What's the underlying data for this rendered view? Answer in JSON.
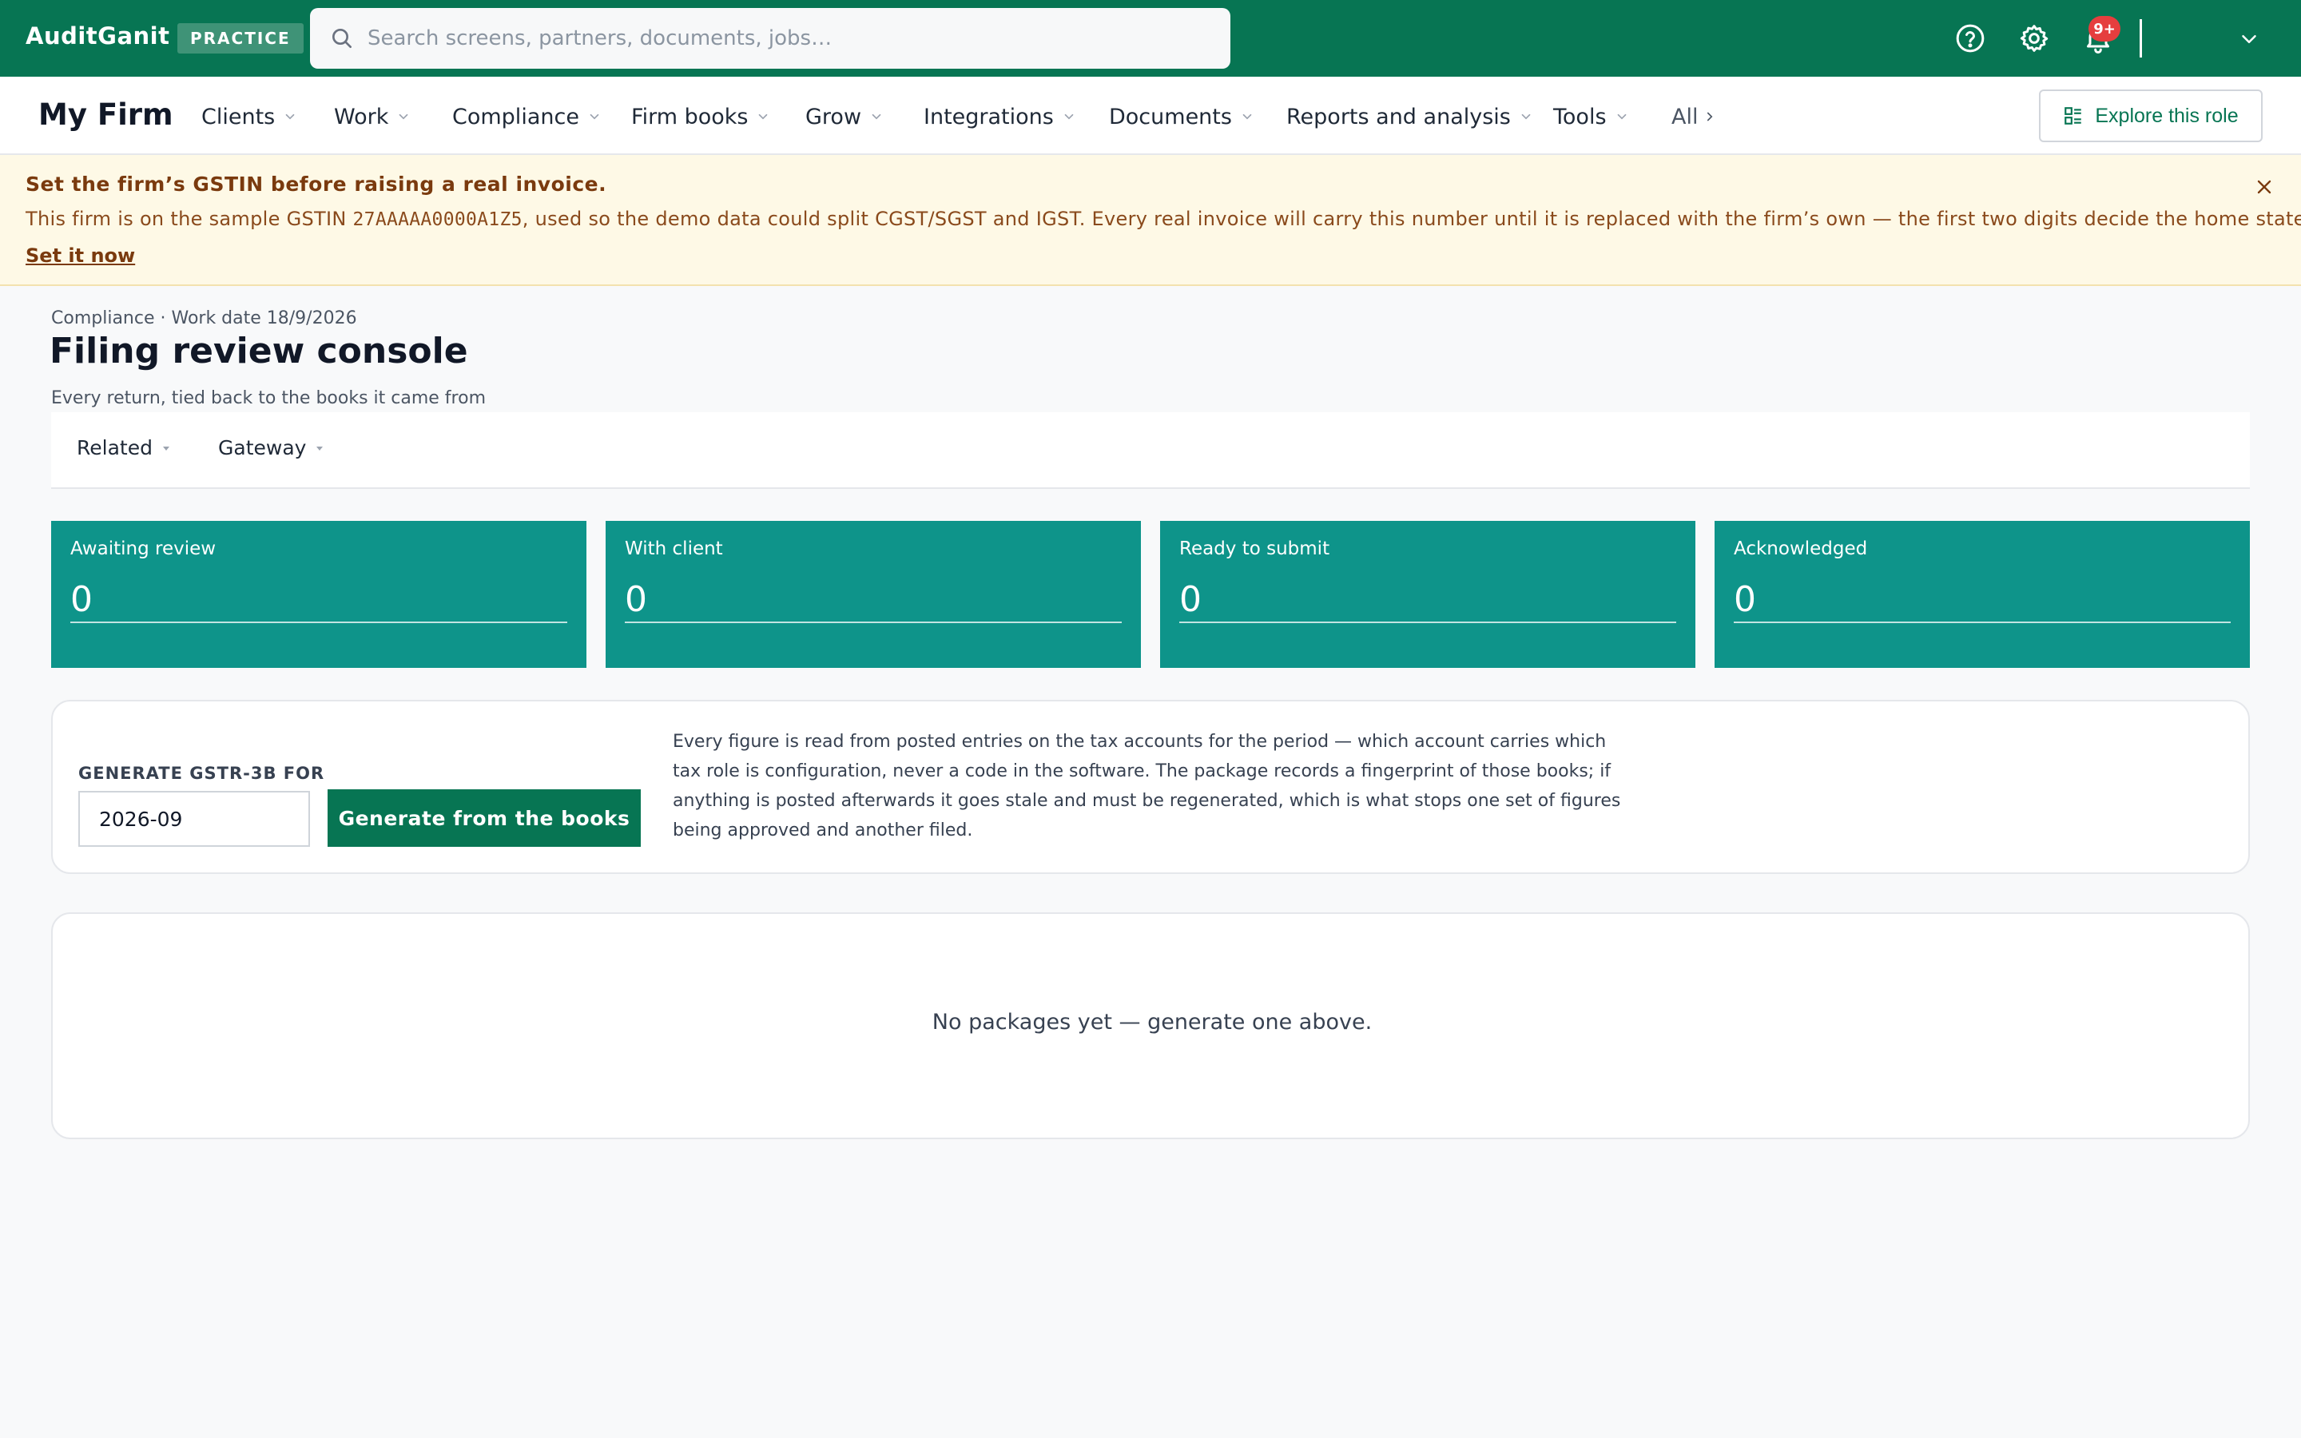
{
  "topbar": {
    "brand": "AuditGanit",
    "badge": "PRACTICE",
    "search_placeholder": "Search screens, partners, documents, jobs…",
    "search_value": "",
    "notifications_badge": "9+"
  },
  "nav": {
    "firm_name": "My Firm",
    "items": [
      {
        "label": "Clients"
      },
      {
        "label": "Work"
      },
      {
        "label": "Compliance"
      },
      {
        "label": "Firm books"
      },
      {
        "label": "Grow"
      },
      {
        "label": "Integrations"
      },
      {
        "label": "Documents"
      },
      {
        "label": "Reports and analysis"
      },
      {
        "label": "Tools"
      }
    ],
    "all_label": "All",
    "explore_label": "Explore this role"
  },
  "banner": {
    "title": "Set the firm’s GSTIN before raising a real invoice.",
    "text_before": "This firm is on the sample GSTIN ",
    "gstin": "27AAAAA0000A1Z5",
    "text_after": ", used so the demo data could split CGST/SGST and IGST. Every real invoice will carry this number until it is replaced with the firm’s own — the first two digits decide the home state.",
    "link": "Set it now"
  },
  "page": {
    "breadcrumb": "Compliance · Work date 18/9/2026",
    "title": "Filing review console",
    "subtitle": "Every return, tied back to the books it came from",
    "tabs": [
      {
        "label": "Related"
      },
      {
        "label": "Gateway"
      }
    ]
  },
  "stats": [
    {
      "label": "Awaiting review",
      "value": "0"
    },
    {
      "label": "With client",
      "value": "0"
    },
    {
      "label": "Ready to submit",
      "value": "0"
    },
    {
      "label": "Acknowledged",
      "value": "0"
    }
  ],
  "generate": {
    "label": "GENERATE GSTR-3B FOR",
    "period_value": "2026-09",
    "button": "Generate from the books",
    "description": "Every figure is read from posted entries on the tax accounts for the period — which account carries which tax role is configuration, never a code in the software. The package records a fingerprint of those books; if anything is posted afterwards it goes stale and must be regenerated, which is what stops one set of figures being approved and another filed."
  },
  "empty_state": "No packages yet — generate one above.",
  "colors": {
    "topbar": "#077553",
    "stat_card": "#0e948a",
    "banner_bg": "#fef9e6",
    "primary_button": "#077553",
    "badge": "#e53e3e"
  },
  "icons": {
    "search": "search-icon",
    "help": "help-icon",
    "settings": "gear-icon",
    "notifications": "bell-icon",
    "account_menu": "chevron-down-icon",
    "explore": "layout-icon",
    "banner_close": "close-icon"
  }
}
